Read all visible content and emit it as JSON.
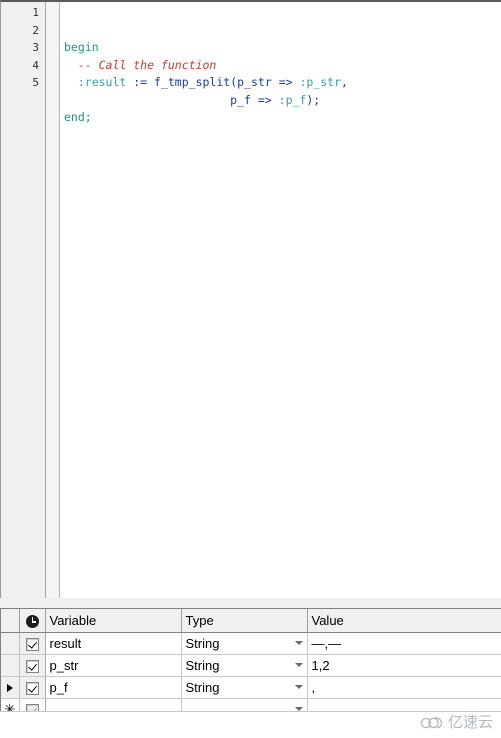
{
  "editor": {
    "line_numbers": [
      "1",
      "2",
      "3",
      "4",
      "5"
    ],
    "lines": [
      {
        "n": "1",
        "segments": [
          {
            "text": "begin",
            "cls": "tok-kw"
          }
        ]
      },
      {
        "n": "2",
        "segments": [
          {
            "text": "  ",
            "cls": "tok-plain"
          },
          {
            "text": "-- Call the function",
            "cls": "tok-comment"
          }
        ]
      },
      {
        "n": "3",
        "segments": [
          {
            "text": "  ",
            "cls": "tok-plain"
          },
          {
            "text": ":result",
            "cls": "tok-bind"
          },
          {
            "text": " := ",
            "cls": "tok-ident"
          },
          {
            "text": "f_tmp_split",
            "cls": "tok-ident"
          },
          {
            "text": "(",
            "cls": "tok-punct"
          },
          {
            "text": "p_str",
            "cls": "tok-ident"
          },
          {
            "text": " => ",
            "cls": "tok-ident"
          },
          {
            "text": ":p_str",
            "cls": "tok-bind"
          },
          {
            "text": ",",
            "cls": "tok-punct"
          }
        ]
      },
      {
        "n": "4",
        "segments": [
          {
            "text": "                        ",
            "cls": "tok-plain"
          },
          {
            "text": "p_f",
            "cls": "tok-ident"
          },
          {
            "text": " => ",
            "cls": "tok-ident"
          },
          {
            "text": ":p_f",
            "cls": "tok-bind"
          },
          {
            "text": ");",
            "cls": "tok-punct"
          }
        ]
      },
      {
        "n": "5",
        "segments": [
          {
            "text": "end;",
            "cls": "tok-kw"
          }
        ]
      }
    ],
    "raw_text": "begin\n  -- Call the function\n  :result := f_tmp_split(p_str => :p_str,\n                        p_f => :p_f);\nend;",
    "colors": {
      "keyword": "#2a8f8a",
      "comment": "#d0392b",
      "bind_variable": "#3a9fa8",
      "identifier": "#1b3fa0",
      "gutter_background": "#f0f0f0",
      "background": "#ffffff"
    }
  },
  "variables_grid": {
    "headers": {
      "selector": "",
      "check": "clock-icon",
      "variable": "Variable",
      "type": "Type",
      "value": "Value"
    },
    "rows": [
      {
        "selected": false,
        "marker": "",
        "checked": true,
        "variable": "result",
        "type": "String",
        "value": "—,—"
      },
      {
        "selected": false,
        "marker": "",
        "checked": true,
        "variable": "p_str",
        "type": "String",
        "value": "1,2"
      },
      {
        "selected": true,
        "marker": "▶",
        "checked": true,
        "variable": "p_f",
        "type": "String",
        "value": ","
      },
      {
        "selected": false,
        "marker": "✳",
        "checked": true,
        "variable": "",
        "type": "",
        "value": "",
        "is_new_row": true
      }
    ],
    "type_options": [
      "String"
    ],
    "colors": {
      "header_background": "#f0f0f0",
      "grid_line": "#c8c8c8",
      "border": "#828282"
    }
  },
  "watermark": {
    "text": "亿速云",
    "icon": "cloud-icon"
  }
}
